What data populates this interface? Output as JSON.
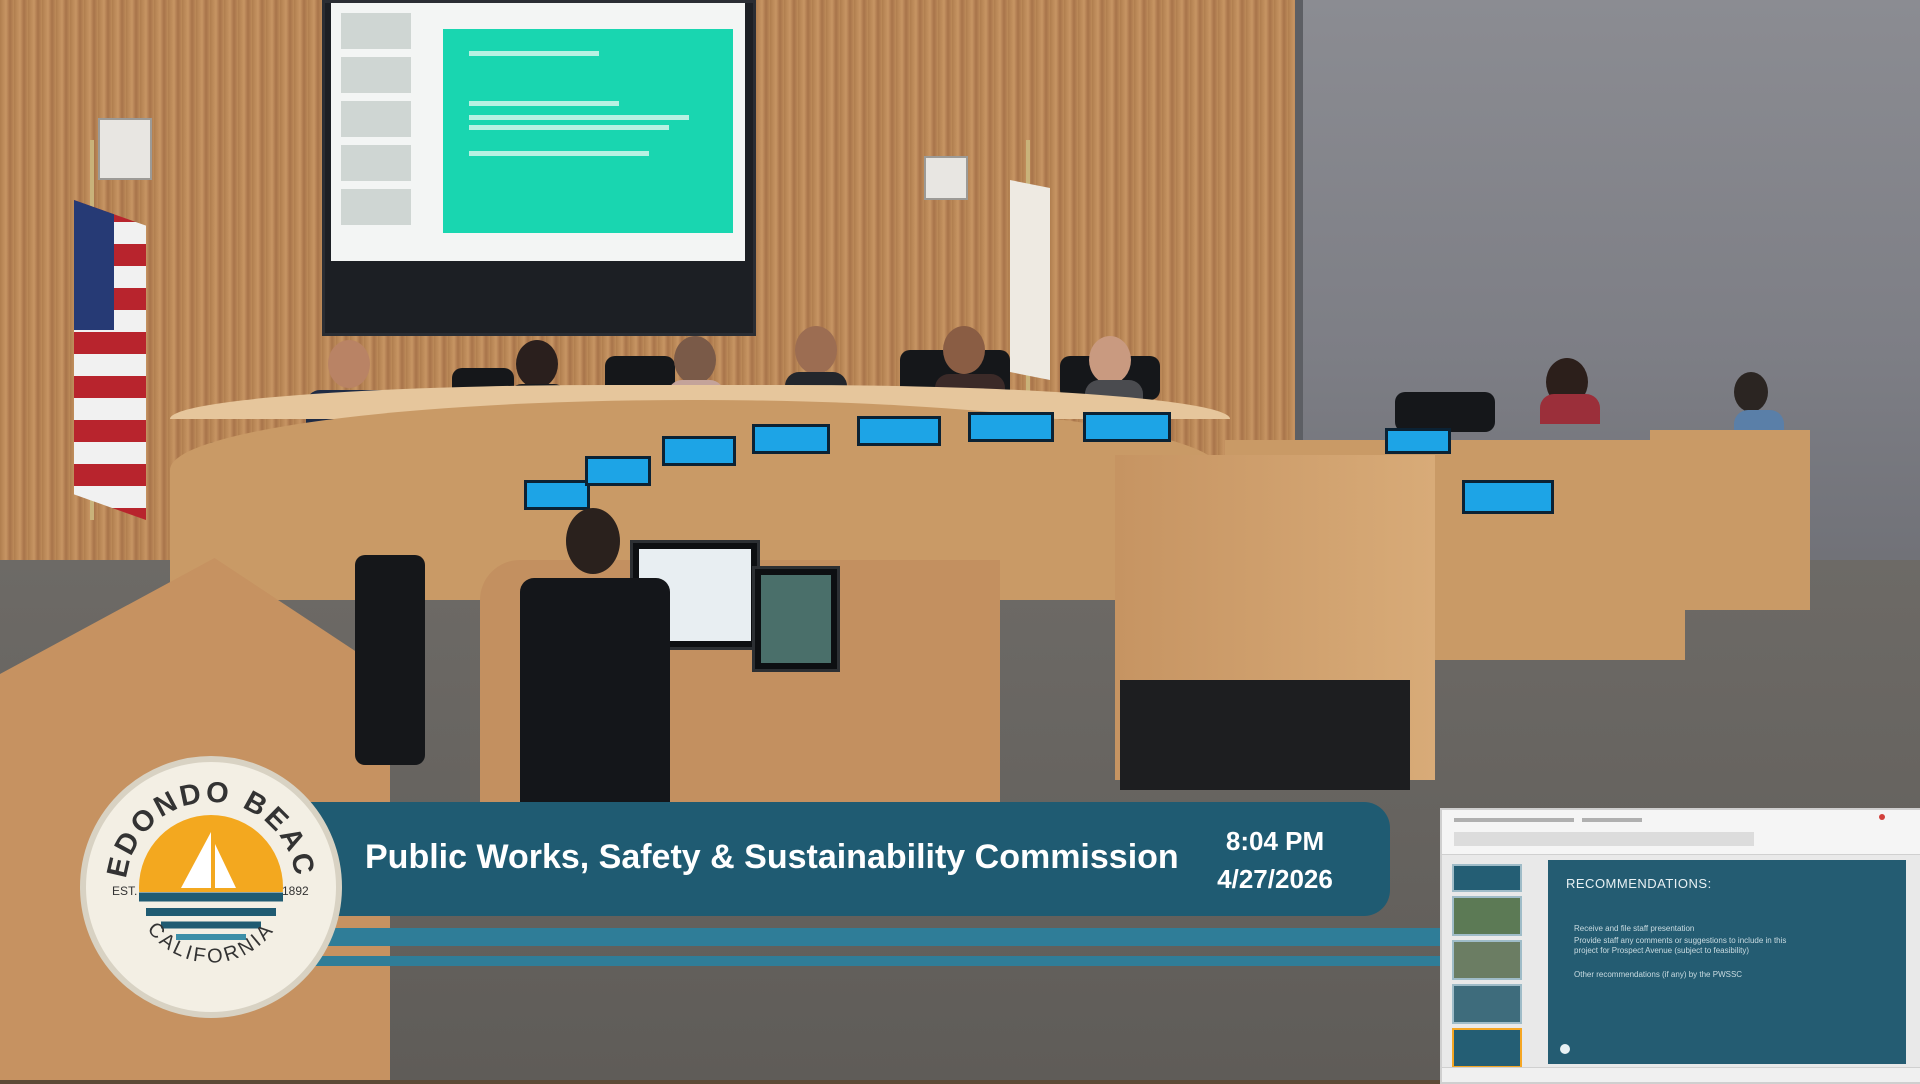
{
  "broadcast": {
    "title": "Public Works, Safety & Sustainability Commission",
    "time": "8:04 PM",
    "date": "4/27/2026"
  },
  "seal": {
    "top_text": "REDONDO BEACH",
    "bottom_text": "CALIFORNIA",
    "est_left": "EST.",
    "est_right": "1892"
  },
  "pip_slide": {
    "title": "RECOMMENDATIONS:",
    "bullets": [
      "Receive and file staff presentation",
      "Provide staff any comments or suggestions to include in this",
      "project for Prospect Avenue (subject to feasibility)",
      "Other recommendations (if any) by the PWSSC"
    ]
  },
  "colors": {
    "banner": "#1f5b72",
    "stripe": "#2f7d98",
    "sun": "#f3a81f",
    "nameplate": "#1da4e6",
    "projection": "#19d6b0"
  }
}
